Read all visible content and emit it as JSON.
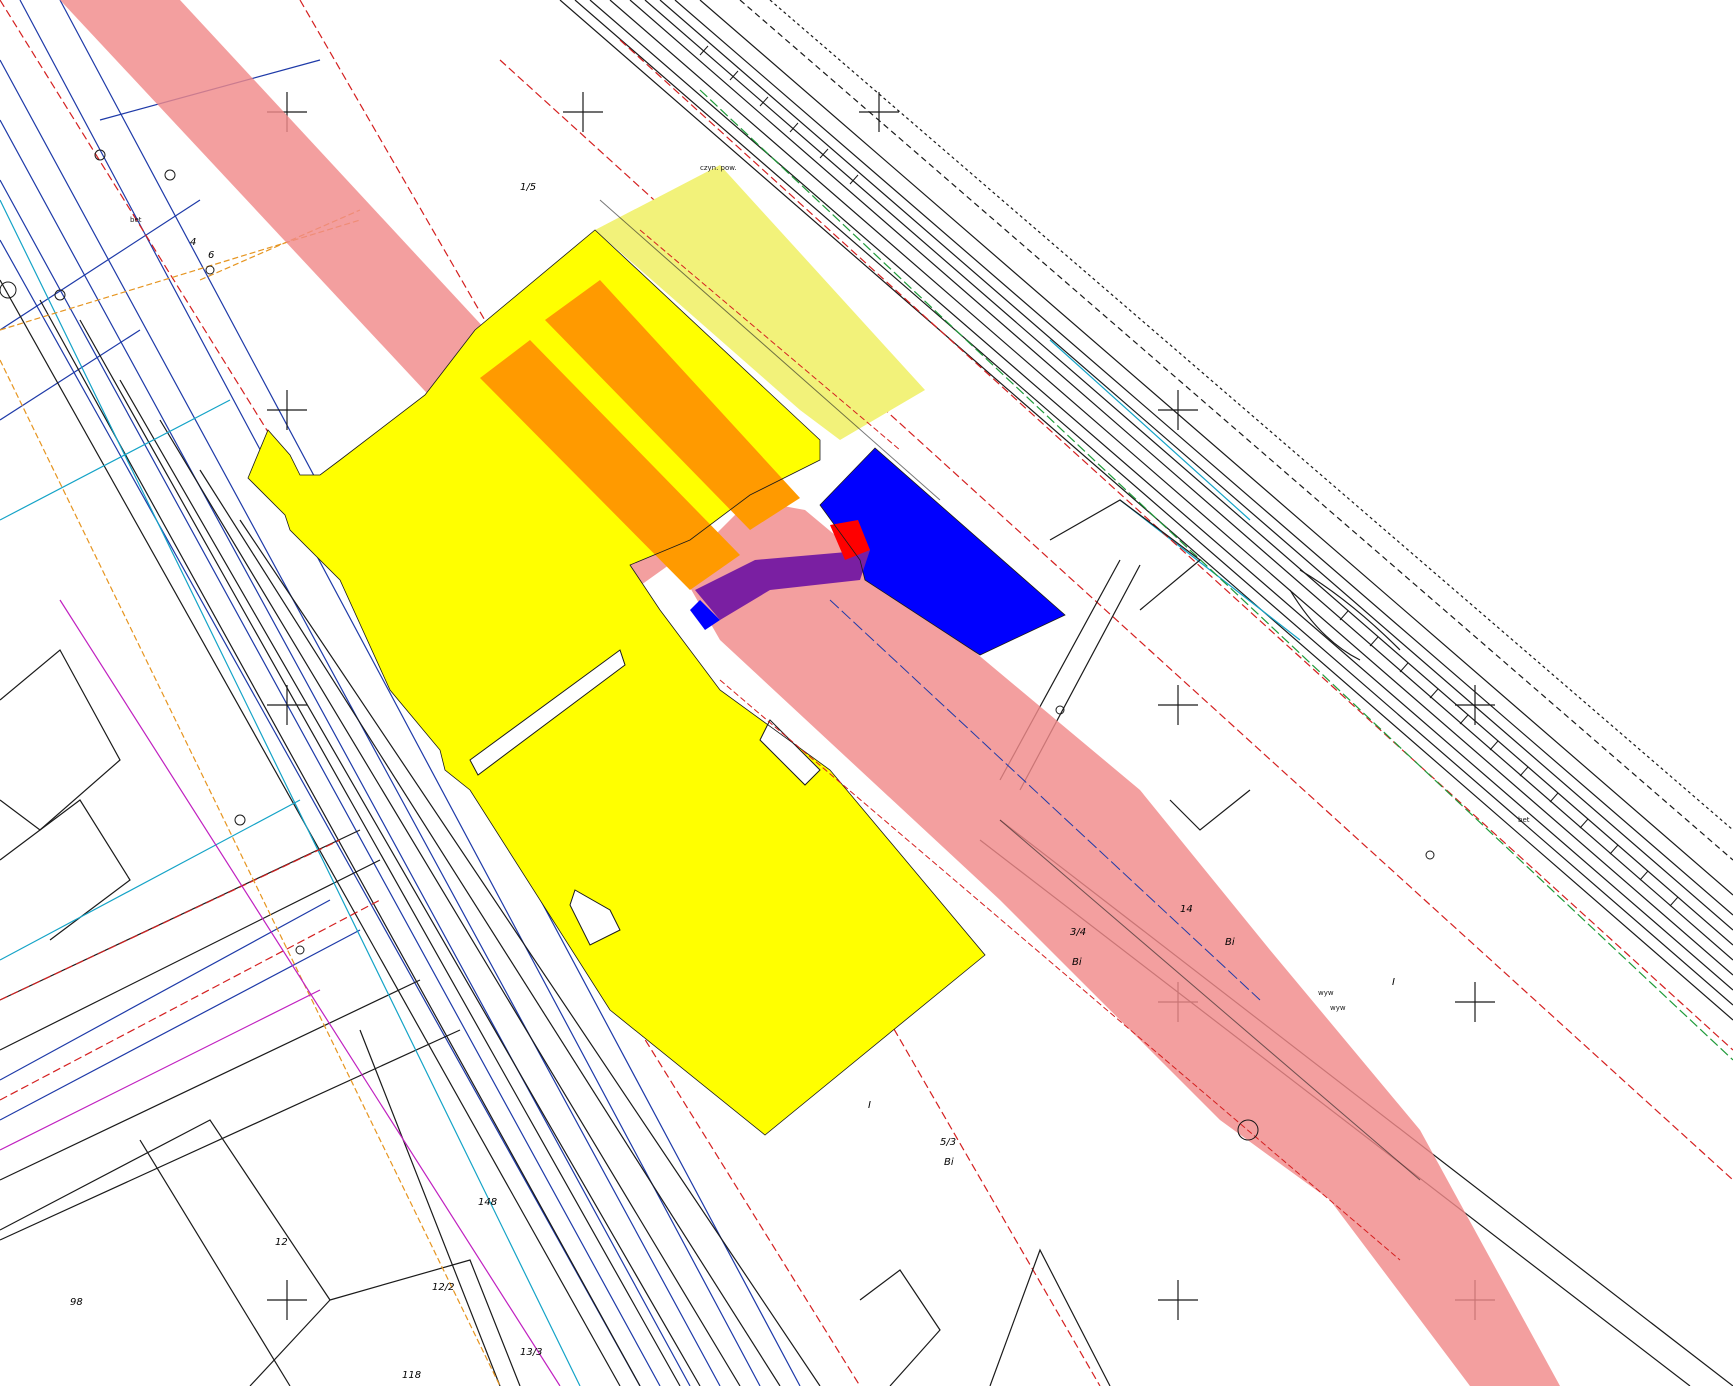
{
  "map": {
    "colors": {
      "background": "#ffffff",
      "pink_zone": "#f08a8a",
      "yellow_zone": "#ffff00",
      "light_yellow_zone": "#f2f27a",
      "orange_overlap": "#ff9a00",
      "blue_zone": "#0000ff",
      "purple_overlap": "#7a1fa2",
      "red_zone": "#ff0000",
      "line_black": "#1a1a1a",
      "line_blue": "#1e3aa8",
      "line_cyan": "#14a3c7",
      "line_red": "#d42020",
      "line_orange": "#e69520",
      "line_magenta": "#c020c0",
      "line_green": "#1f9a3a"
    },
    "parcel_labels": [
      {
        "id": "lbl-5-3",
        "text": "5/3"
      },
      {
        "id": "lbl-bi-1",
        "text": "Bi"
      },
      {
        "id": "lbl-1-5",
        "text": "1/5"
      },
      {
        "id": "lbl-3-4",
        "text": "3/4"
      },
      {
        "id": "lbl-bi-2",
        "text": "Bi"
      },
      {
        "id": "lbl-14",
        "text": "14"
      },
      {
        "id": "lbl-bi-3",
        "text": "Bi"
      },
      {
        "id": "lbl-98",
        "text": "98"
      },
      {
        "id": "lbl-12-2",
        "text": "12/2"
      },
      {
        "id": "lbl-13-3",
        "text": "13/3"
      },
      {
        "id": "lbl-118",
        "text": "118"
      },
      {
        "id": "lbl-148",
        "text": "148"
      },
      {
        "id": "lbl-12",
        "text": "12"
      },
      {
        "id": "lbl-4",
        "text": "4"
      },
      {
        "id": "lbl-6",
        "text": "6"
      },
      {
        "id": "lbl-i",
        "text": "I"
      },
      {
        "id": "lbl-i2",
        "text": "I"
      }
    ],
    "small_labels": [
      {
        "id": "lbl-czyn",
        "text": "czyn. pow."
      },
      {
        "id": "lbl-wyw1",
        "text": "wyw"
      },
      {
        "id": "lbl-wyw2",
        "text": "wyw"
      },
      {
        "id": "lbl-bet",
        "text": "bet"
      },
      {
        "id": "lbl-bet2",
        "text": "bet"
      }
    ]
  }
}
